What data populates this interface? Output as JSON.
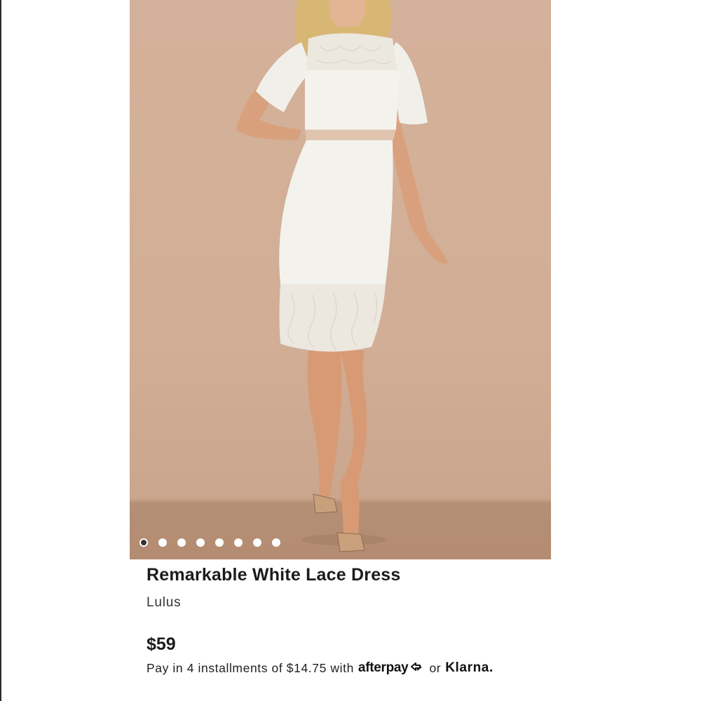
{
  "product": {
    "title": "Remarkable White Lace Dress",
    "brand": "Lulus",
    "price": "$59",
    "image_description_icon": "dress-photo",
    "gallery": {
      "total": 8,
      "active_index": 0
    }
  },
  "payment": {
    "installment_text": "Pay in 4 installments of $14.75 with",
    "afterpay_label": "afterpay",
    "or_text": "or",
    "klarna_label": "Klarna."
  },
  "colors": {
    "backdrop": "#d4b19a",
    "floor": "#b58f75",
    "dress": "#f3f1ec",
    "text": "#1c1c1c"
  }
}
